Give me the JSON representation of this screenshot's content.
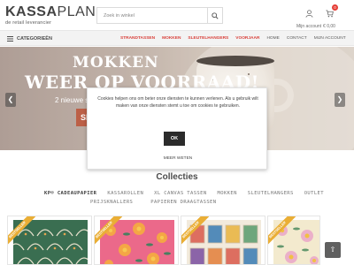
{
  "header": {
    "logo_bold": "KASSA",
    "logo_light": "PLAN",
    "logo_tagline": "de retail leverancier",
    "search_placeholder": "Zoek in winkel",
    "account_label": "Mijn account",
    "cart_count": "0",
    "cart_amount": "€ 0,00"
  },
  "nav": {
    "categories_label": "CATEGORIEËN",
    "links": [
      {
        "label": "STRANDTASSEN",
        "style": "red"
      },
      {
        "label": "MOKKEN",
        "style": "red"
      },
      {
        "label": "SLEUTELHANGERS",
        "style": "red"
      },
      {
        "label": "VOORJAAR",
        "style": "red"
      },
      {
        "label": "HOME",
        "style": "grey"
      },
      {
        "label": "CONTACT",
        "style": "grey"
      },
      {
        "label": "MIJN ACCOUNT",
        "style": "grey"
      }
    ]
  },
  "hero": {
    "title_line1": "MOKKEN",
    "title_line2": "WEER OP VOORRAAD!",
    "subtitle": "2 nieuwe s",
    "cta": "SH"
  },
  "cookie": {
    "text": "Cookies helpen ons om beter onze diensten te kunnen verlenen. Als u gebruik wilt maken van onze diensten stemt u toe om cookies te gebruiken.",
    "ok_label": "OK",
    "more_label": "MEER WETEN"
  },
  "collections": {
    "title": "Collecties",
    "tabs_row1": [
      "KP® CADEAUPAPIER",
      "KASSAROLLEN",
      "XL CANVAS TASSEN",
      "MOKKEN",
      "SLEUTELHANGERS",
      "OUTLET"
    ],
    "tabs_row2": [
      "PRIJSKNALLERS",
      "PAPIEREN DRAAGTASSEN"
    ],
    "active_tab": "KP® CADEAUPAPIER"
  },
  "products": [
    {
      "ribbon": "BESTSELLER",
      "pattern": "green-fan"
    },
    {
      "ribbon": "BESTSELLER",
      "pattern": "pink-orange-floral"
    },
    {
      "ribbon": "BESTSELLER",
      "pattern": "stamp-grid"
    },
    {
      "ribbon": "BESTSELLER",
      "pattern": "yellow-floral"
    }
  ],
  "colors": {
    "accent_red": "#d4261f",
    "ribbon_orange": "#e7a31a",
    "dark_button": "#2b2b2b"
  }
}
